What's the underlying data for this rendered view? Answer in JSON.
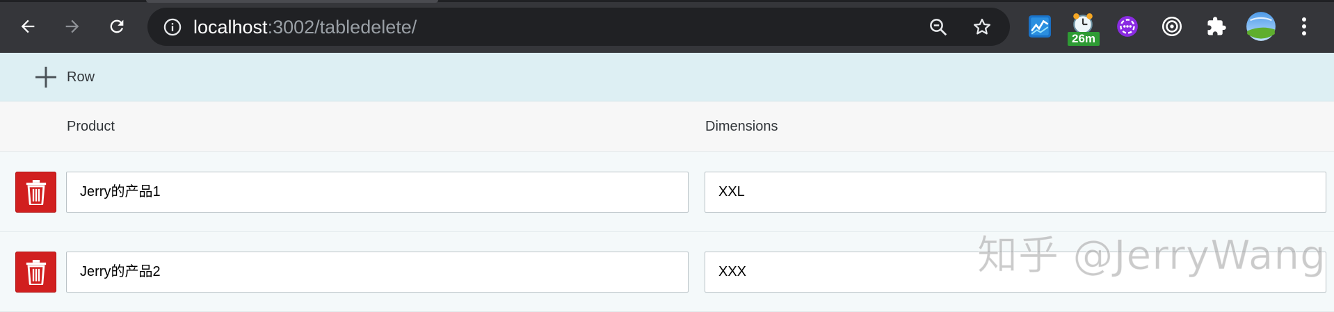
{
  "browser": {
    "url_host": "localhost",
    "url_path": ":3002/tabledelete/",
    "extensions": [
      {
        "name": "stock-chart-extension-icon"
      },
      {
        "name": "alarm-clock-extension-icon",
        "badge": "26m"
      },
      {
        "name": "purple-chat-extension-icon"
      },
      {
        "name": "target-extension-icon"
      },
      {
        "name": "puzzle-extensions-icon"
      },
      {
        "name": "profile-avatar"
      }
    ]
  },
  "toolbar": {
    "add_row_label": "Row"
  },
  "table": {
    "columns": [
      "Product",
      "Dimensions"
    ],
    "rows": [
      {
        "product": "Jerry的产品1",
        "dimensions": "XXL"
      },
      {
        "product": "Jerry的产品2",
        "dimensions": "XXX"
      }
    ]
  },
  "watermark": "知乎 @JerryWang",
  "colors": {
    "toolbar_bg": "#ddeff3",
    "delete_button": "#d11f1f",
    "chrome_bg": "#35363a"
  }
}
